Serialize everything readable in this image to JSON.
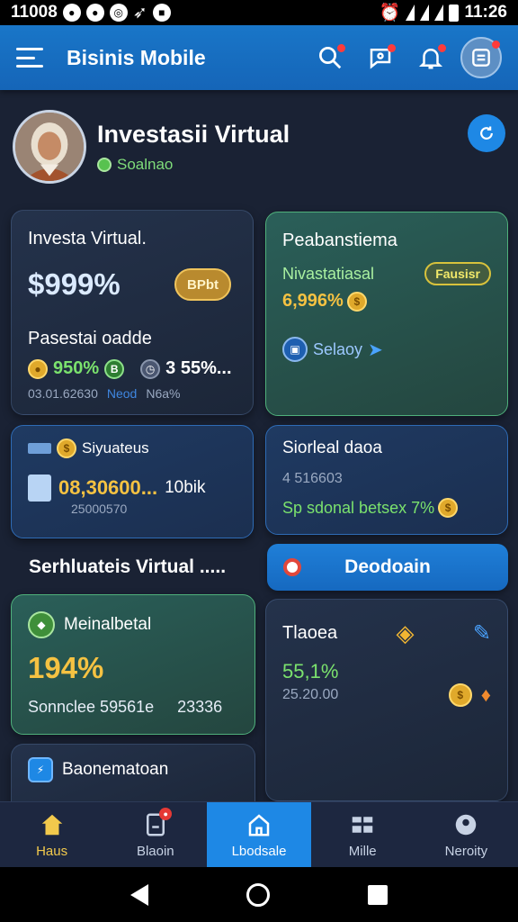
{
  "status_bar": {
    "time_left": "11008",
    "time_right": "11:26"
  },
  "app_bar": {
    "title": "Bisinis Mobile"
  },
  "profile": {
    "title": "Investasii Virtual",
    "status": "Soalnao"
  },
  "card_portfolio": {
    "title": "Investa Virtual.",
    "value": "$999%",
    "pill": "BPbt",
    "subtitle": "Pasestai oadde",
    "stat1": "950%",
    "stat2": "3 55%...",
    "footer_date": "03.01.62630",
    "footer_a": "Neod",
    "footer_b": "N6a%"
  },
  "card_summary": {
    "title": "Peabanstiema",
    "subtitle": "Nivastatiasal",
    "pill": "Fausisr",
    "value": "6,996%",
    "action": "Selaoy"
  },
  "card_stats": {
    "title": "Siyuateus",
    "value": "08,30600...",
    "value_suffix": "10bik",
    "sub": "25000570"
  },
  "card_rate": {
    "title": "Siorleal daoa",
    "value": "4 516603",
    "note": "Sp sdonal betsex 7%"
  },
  "section": {
    "title": "Serhluateis Virtual ....."
  },
  "primary_button": {
    "label": "Deodoain"
  },
  "card_green": {
    "title": "Meinalbetal",
    "value": "194%",
    "left": "Sonnclee 59561e",
    "right": "23336"
  },
  "card_tiaea": {
    "title": "Tlaoea",
    "value": "55,1%",
    "sub": "25.20.00"
  },
  "card_bottom": {
    "title": "Baonematoan"
  },
  "bottom_nav": [
    {
      "label": "Haus"
    },
    {
      "label": "Blaoin"
    },
    {
      "label": "Lbodsale"
    },
    {
      "label": "Mille"
    },
    {
      "label": "Neroity"
    }
  ],
  "colors": {
    "accent": "#1e88e5",
    "gold": "#f2c94c",
    "green": "#7fdc7a"
  }
}
